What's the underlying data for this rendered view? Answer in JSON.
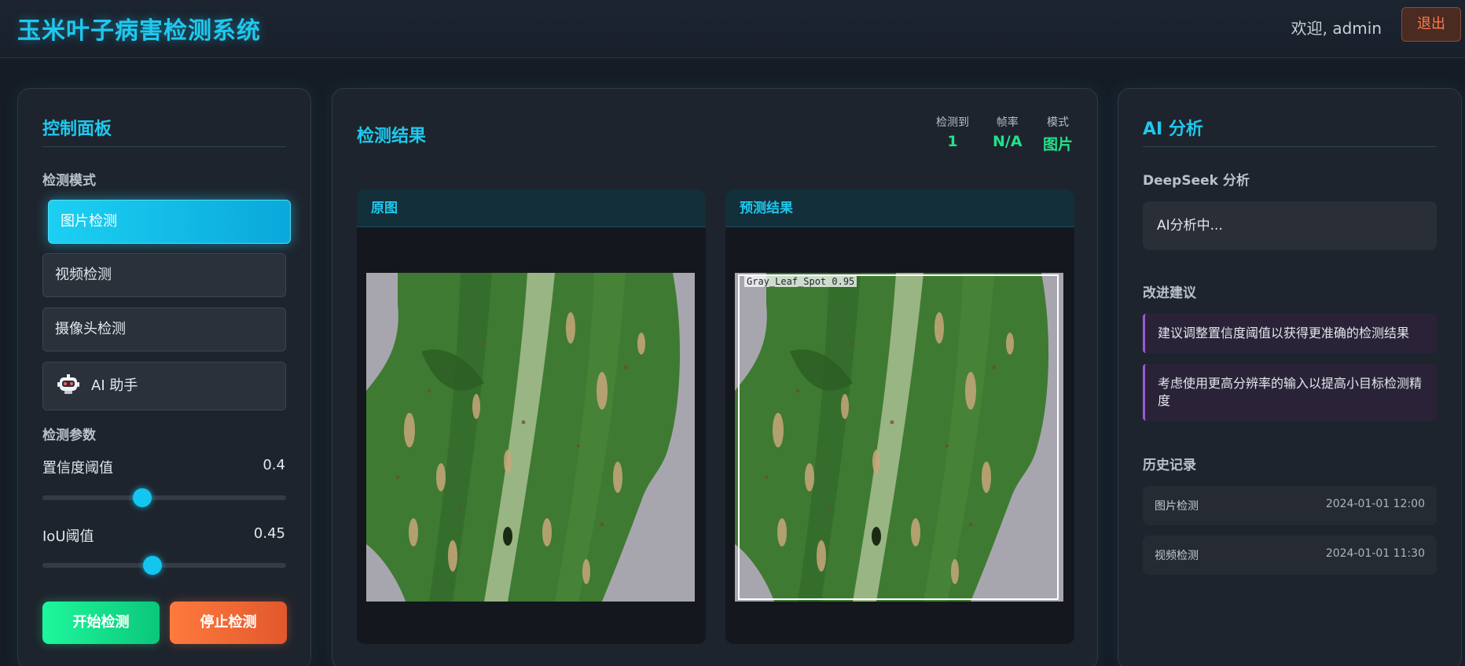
{
  "header": {
    "app_title": "玉米叶子病害检测系统",
    "welcome": "欢迎, admin",
    "logout_label": "退出"
  },
  "control_panel": {
    "title": "控制面板",
    "mode_section": "检测模式",
    "modes": [
      {
        "label": "图片检测",
        "active": true
      },
      {
        "label": "视频检测",
        "active": false
      },
      {
        "label": "摄像头检测",
        "active": false
      },
      {
        "label": "AI 助手",
        "icon": "robot-icon",
        "active": false
      }
    ],
    "param_section": "检测参数",
    "params": [
      {
        "label": "置信度阈值",
        "value": "0.4"
      },
      {
        "label": "IoU阈值",
        "value": "0.45"
      }
    ],
    "start_label": "开始检测",
    "stop_label": "停止检测"
  },
  "results": {
    "title": "检测结果",
    "stats": [
      {
        "label": "检测到",
        "value": "1"
      },
      {
        "label": "帧率",
        "value": "N/A"
      },
      {
        "label": "模式",
        "value": "图片"
      }
    ],
    "original_title": "原图",
    "predicted_title": "预测结果",
    "detection_label": "Gray_Leaf_Spot 0.95"
  },
  "ai_analysis": {
    "title": "AI 分析",
    "deepseek_title": "DeepSeek 分析",
    "status": "AI分析中...",
    "suggest_title": "改进建议",
    "suggestions": [
      "建议调整置信度阈值以获得更准确的检测结果",
      "考虑使用更高分辨率的输入以提高小目标检测精度"
    ],
    "history_title": "历史记录",
    "history": [
      {
        "type": "图片检测",
        "time": "2024-01-01 12:00"
      },
      {
        "type": "视频检测",
        "time": "2024-01-01 11:30"
      }
    ]
  },
  "colors": {
    "accent": "#1fc8ee",
    "success": "#21e28a",
    "danger": "#ff7a4d",
    "suggestion_bar": "#9b59d6"
  }
}
